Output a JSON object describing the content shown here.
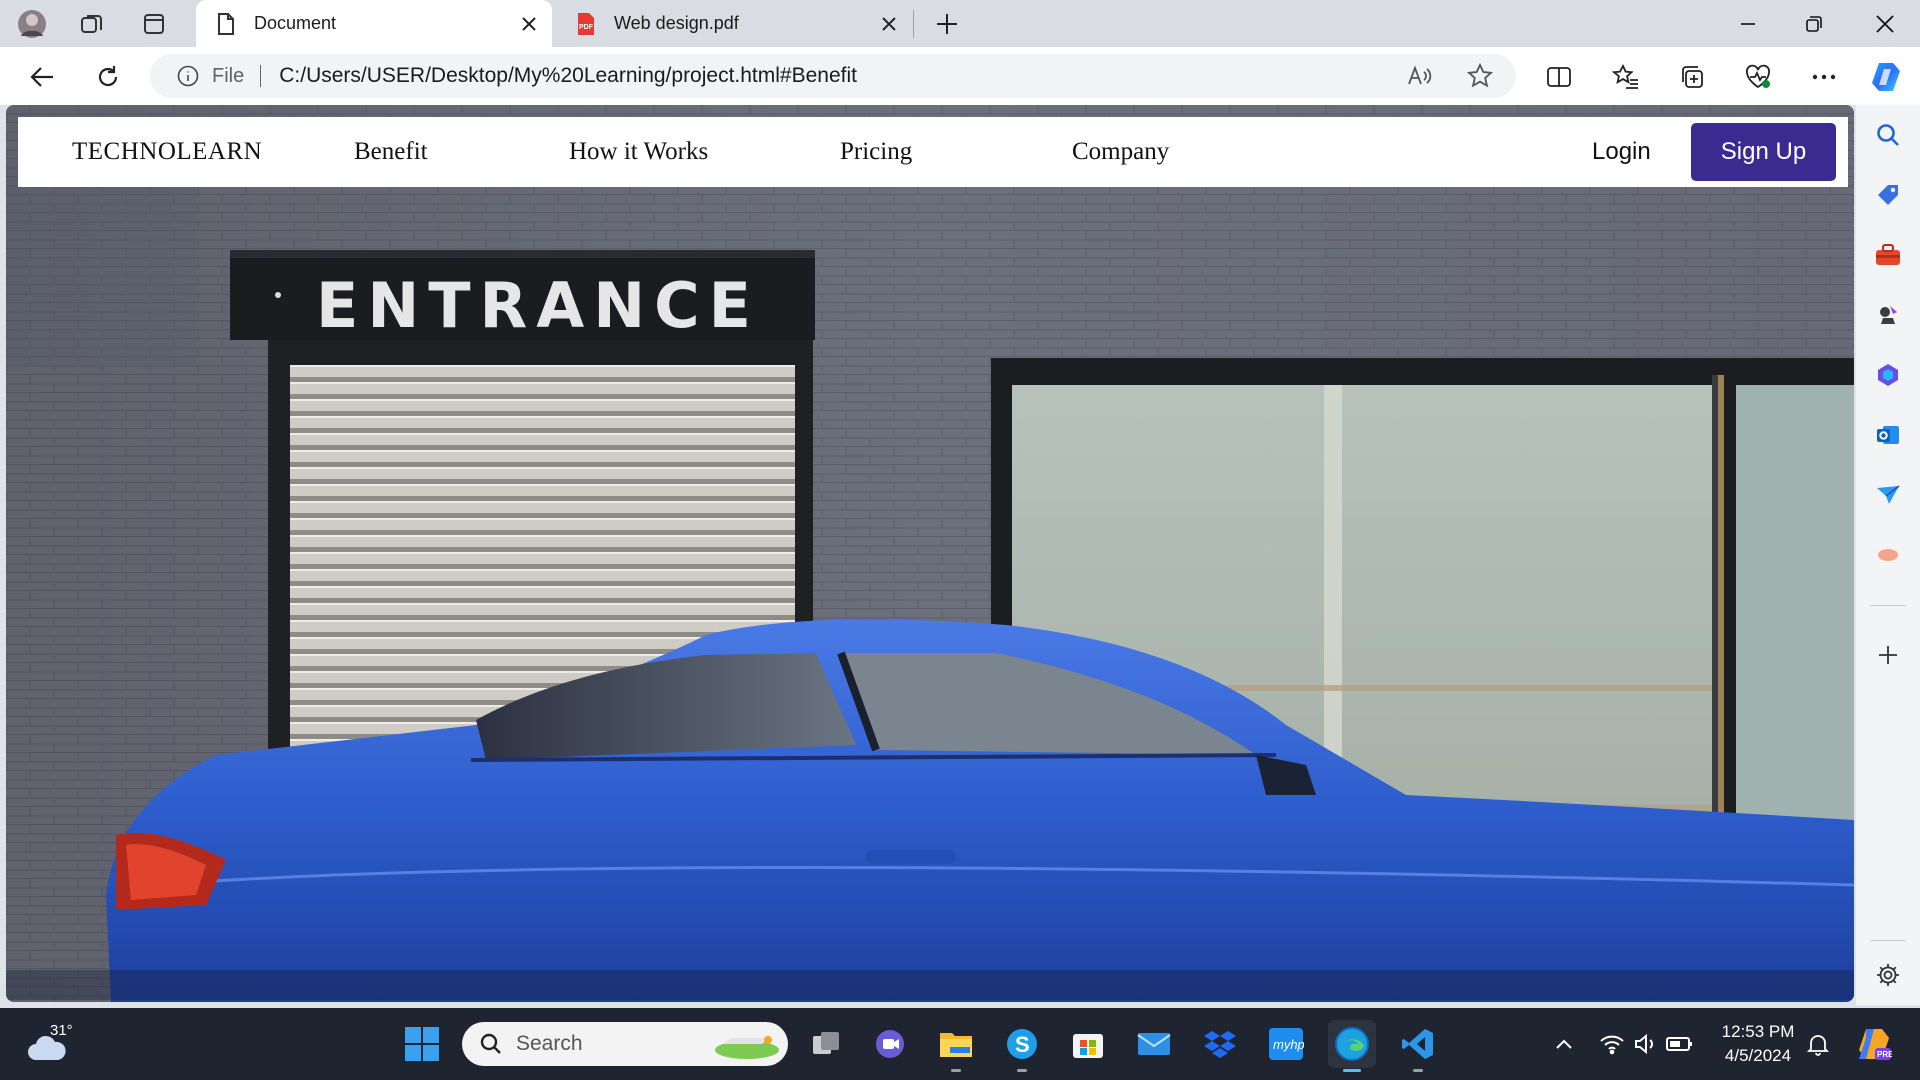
{
  "tabs": [
    {
      "title": "Document",
      "icon": "document-icon",
      "active": true
    },
    {
      "title": "Web design.pdf",
      "icon": "pdf-icon",
      "active": false
    }
  ],
  "address_bar": {
    "scheme_label": "File",
    "url": "C:/Users/USER/Desktop/My%20Learning/project.html#Benefit"
  },
  "site": {
    "brand": "TECHNOLEARN",
    "nav": [
      "Benefit",
      "How it Works",
      "Pricing",
      "Company"
    ],
    "login": "Login",
    "signup": "Sign Up",
    "signup_color": "#3b2a8f",
    "hero_sign": "ENTRANCE"
  },
  "taskbar": {
    "weather_temp": "31°",
    "search_placeholder": "Search",
    "time": "12:53 PM",
    "date": "4/5/2024"
  },
  "colors": {
    "accent": "#3b2a8f",
    "car_blue": "#2f5fd0",
    "wall": "#6b6e7a",
    "taskbar": "#1f2530"
  }
}
